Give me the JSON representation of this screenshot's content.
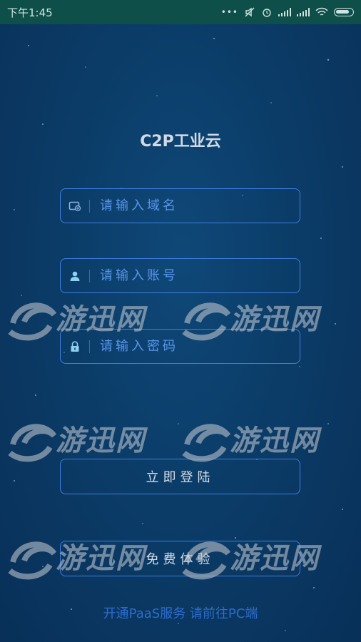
{
  "status_bar": {
    "time": "下午1:45"
  },
  "app": {
    "title": "C2P工业云"
  },
  "form": {
    "domain_placeholder": "请输入域名",
    "account_placeholder": "请输入账号",
    "password_placeholder": "请输入密码"
  },
  "buttons": {
    "login": "立即登陆",
    "trial": "免费体验"
  },
  "footer": {
    "note": "开通PaaS服务 请前往PC端"
  },
  "watermark": {
    "text": "游迅网"
  },
  "colors": {
    "background": "#0b3c68",
    "accent": "#3f7ee0",
    "status_bar": "#0f4f4a",
    "footer_text": "#2d6ccd"
  }
}
